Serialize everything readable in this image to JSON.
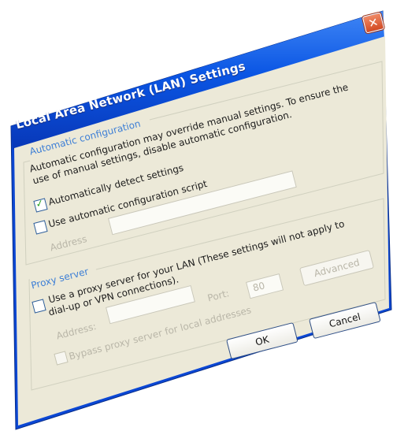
{
  "window": {
    "title": "Local Area Network (LAN) Settings",
    "close_glyph": "✕"
  },
  "auto": {
    "legend": "Automatic configuration",
    "description_line1": "Automatic configuration may override manual settings.  To ensure the",
    "description_line2": "use of manual settings, disable automatic configuration.",
    "detect_label": "Automatically detect settings",
    "detect_checked": true,
    "script_label": "Use automatic configuration script",
    "script_checked": false,
    "address_label": "Address",
    "address_value": ""
  },
  "proxy": {
    "legend": "Proxy server",
    "use_label_line1": "Use a proxy server for your LAN (These settings will not apply to",
    "use_label_line2": "dial-up or VPN connections).",
    "use_checked": false,
    "address_label": "Address:",
    "address_value": "",
    "port_label": "Port:",
    "port_value": "80",
    "advanced_label": "Advanced",
    "bypass_label": "Bypass proxy server for local addresses",
    "bypass_checked": false
  },
  "buttons": {
    "ok_label": "OK",
    "cancel_label": "Cancel"
  },
  "colors": {
    "titlebar": "#0a45d9",
    "dialog_bg": "#ece9d8",
    "legend_text": "#3d7fd6",
    "close_button": "#e05a33"
  }
}
